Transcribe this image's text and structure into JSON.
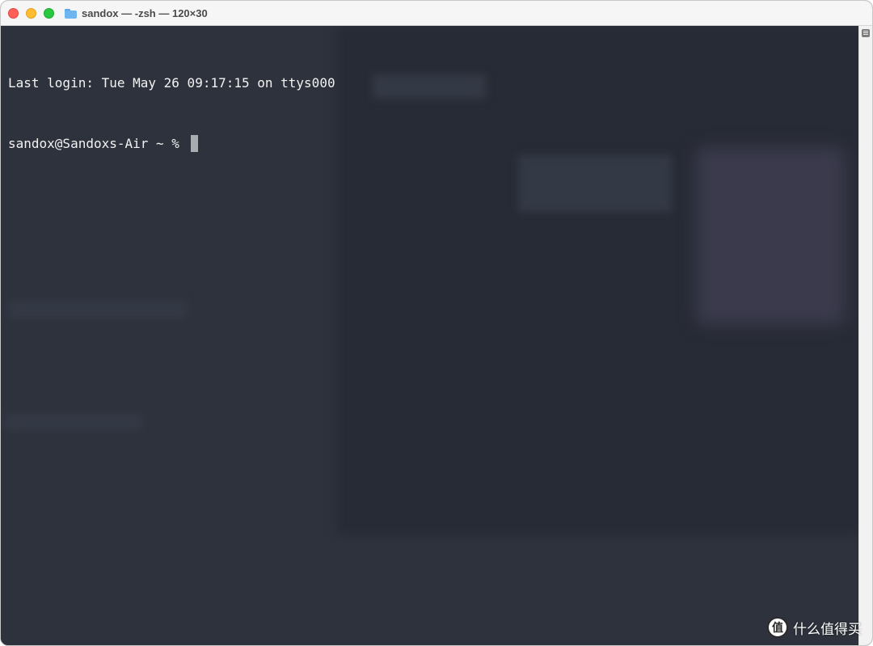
{
  "window": {
    "title": "sandox — -zsh — 120×30"
  },
  "terminal": {
    "lines": [
      "Last login: Tue May 26 09:17:15 on ttys000",
      "sandox@Sandoxs-Air ~ % "
    ]
  },
  "watermark": {
    "logo_glyph": "值",
    "text": "什么值得买"
  },
  "icons": [
    "close-icon",
    "minimize-icon",
    "zoom-icon",
    "folder-icon",
    "scroll-handle-icon"
  ],
  "colors": {
    "terminal_bg": "#2e323c",
    "text": "#f2f2f2",
    "cursor": "#a8abb0",
    "close": "#ff5f57",
    "minimize": "#febc2e",
    "zoom": "#28c840"
  }
}
